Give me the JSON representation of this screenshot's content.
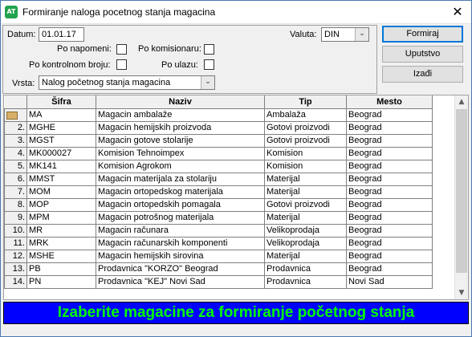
{
  "window": {
    "app_icon_text": "AT",
    "title": "Formiranje naloga pocetnog stanja magacina",
    "close_glyph": "✕"
  },
  "form": {
    "datum_label": "Datum:",
    "datum_value": "01.01.17",
    "valuta_label": "Valuta:",
    "valuta_value": "DIN",
    "po_napomeni_label": "Po napomeni:",
    "po_komisionaru_label": "Po komisionaru:",
    "po_kontrolnom_broju_label": "Po kontrolnom broju:",
    "po_ulazu_label": "Po ulazu:",
    "vrsta_label": "Vrsta:",
    "vrsta_value": "Nalog početnog stanja magacina",
    "dropdown_glyph": "⌄"
  },
  "buttons": {
    "formiraj": "Formiraj",
    "uputstvo": "Uputstvo",
    "izadji": "Izađi"
  },
  "grid": {
    "columns": [
      "Šifra",
      "Naziv",
      "Tip",
      "Mesto"
    ],
    "rows": [
      {
        "num": "",
        "sifra": "MA",
        "naziv": "Magacin ambalaže",
        "tip": "Ambalaža",
        "mesto": "Beograd"
      },
      {
        "num": "2.",
        "sifra": "MGHE",
        "naziv": "Magacin hemijskih proizvoda",
        "tip": "Gotovi proizvodi",
        "mesto": "Beograd"
      },
      {
        "num": "3.",
        "sifra": "MGST",
        "naziv": "Magacin gotove stolarije",
        "tip": "Gotovi proizvodi",
        "mesto": "Beograd"
      },
      {
        "num": "4.",
        "sifra": "MK000027",
        "naziv": "Komision Tehnoimpex",
        "tip": "Komision",
        "mesto": "Beograd"
      },
      {
        "num": "5.",
        "sifra": "MK141",
        "naziv": "Komision Agrokom",
        "tip": "Komision",
        "mesto": "Beograd"
      },
      {
        "num": "6.",
        "sifra": "MMST",
        "naziv": "Magacin materijala za stolariju",
        "tip": "Materijal",
        "mesto": "Beograd"
      },
      {
        "num": "7.",
        "sifra": "MOM",
        "naziv": "Magacin ortopedskog materijala",
        "tip": "Materijal",
        "mesto": "Beograd"
      },
      {
        "num": "8.",
        "sifra": "MOP",
        "naziv": "Magacin ortopedskih pomagala",
        "tip": "Gotovi proizvodi",
        "mesto": "Beograd"
      },
      {
        "num": "9.",
        "sifra": "MPM",
        "naziv": "Magacin potrošnog materijala",
        "tip": "Materijal",
        "mesto": "Beograd"
      },
      {
        "num": "10.",
        "sifra": "MR",
        "naziv": "Magacin računara",
        "tip": "Velikoprodaja",
        "mesto": "Beograd"
      },
      {
        "num": "11.",
        "sifra": "MRK",
        "naziv": "Magacin računarskih komponenti",
        "tip": "Velikoprodaja",
        "mesto": "Beograd"
      },
      {
        "num": "12.",
        "sifra": "MSHE",
        "naziv": "Magacin hemijskih sirovina",
        "tip": "Materijal",
        "mesto": "Beograd"
      },
      {
        "num": "13.",
        "sifra": "PB",
        "naziv": "Prodavnica \"KORZO\" Beograd",
        "tip": "Prodavnica",
        "mesto": "Beograd"
      },
      {
        "num": "14.",
        "sifra": "PN",
        "naziv": "Prodavnica \"KEJ\" Novi Sad",
        "tip": "Prodavnica",
        "mesto": "Novi Sad"
      }
    ],
    "scroll_up_glyph": "▲",
    "scroll_down_glyph": "▼"
  },
  "status_message": "Izaberite magacine za formiranje početnog stanja",
  "colors": {
    "status_bg": "#0000ff",
    "status_text": "#00ff00",
    "app_icon": "#23a24d"
  }
}
